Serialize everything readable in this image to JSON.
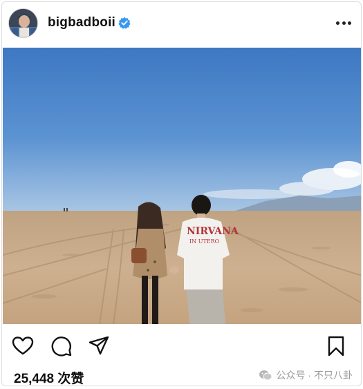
{
  "post": {
    "username": "bigbadboii",
    "verified": true
  },
  "photo": {
    "shirt_text_line1": "NIRVANA",
    "shirt_text_line2": "IN UTERO"
  },
  "actions": {
    "like_icon": "heart-icon",
    "comment_icon": "comment-icon",
    "share_icon": "send-icon",
    "save_icon": "bookmark-icon"
  },
  "likes_label": "25,448 次赞",
  "watermark": {
    "text": "公众号 · 不只八卦",
    "icon": "wechat-icon"
  },
  "colors": {
    "verified_blue": "#3897f0",
    "sky_top": "#3d78c2",
    "sand": "#c9ab88"
  }
}
